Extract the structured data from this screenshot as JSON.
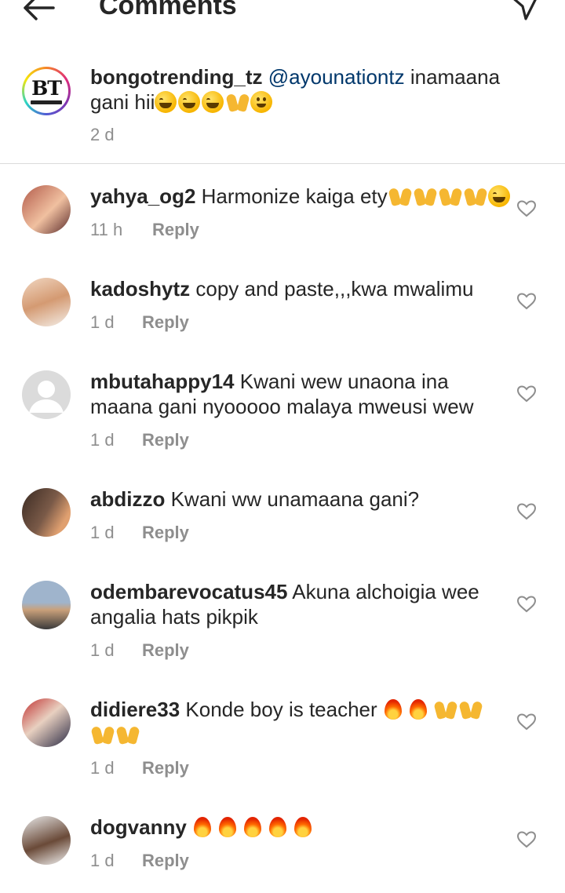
{
  "header": {
    "title": "Comments",
    "back_icon": "arrow-left-icon",
    "send_icon": "paper-plane-icon"
  },
  "caption": {
    "avatar_text": "BT",
    "username": "bongotrending_tz",
    "mention": "@ayounationtz",
    "text_line1": "inamaana",
    "text_line2": "gani hii",
    "time": "2 d"
  },
  "reply_label": "Reply",
  "comments": [
    {
      "username": "yahya_og2",
      "text": "Harmonize kaiga ety",
      "time": "11 h",
      "avatar_color": "#c9826b"
    },
    {
      "username": "kadoshytz",
      "text": "copy and paste,,,kwa mwalimu",
      "time": "1 d",
      "avatar_color": "#d8a98a"
    },
    {
      "username": "mbutahappy14",
      "text": "Kwani wew unaona ina",
      "text2": "maana gani nyooooo malaya mweusi wew",
      "time": "1 d",
      "avatar_color": "#dbdbdb"
    },
    {
      "username": "abdizzo",
      "text": "Kwani ww unamaana gani?",
      "time": "1 d",
      "avatar_color": "#6a4a3a"
    },
    {
      "username": "odembarevocatus45",
      "text": "Akuna alchoigia wee",
      "text2": "angalia hats pikpik",
      "time": "1 d",
      "avatar_color": "#a7b4c4"
    },
    {
      "username": "didiere33",
      "text": "Konde boy is teacher",
      "time": "1 d",
      "avatar_color": "#8c6d6d"
    },
    {
      "username": "dogvanny",
      "text": "",
      "time": "1 d",
      "avatar_color": "#7d5a48"
    }
  ]
}
